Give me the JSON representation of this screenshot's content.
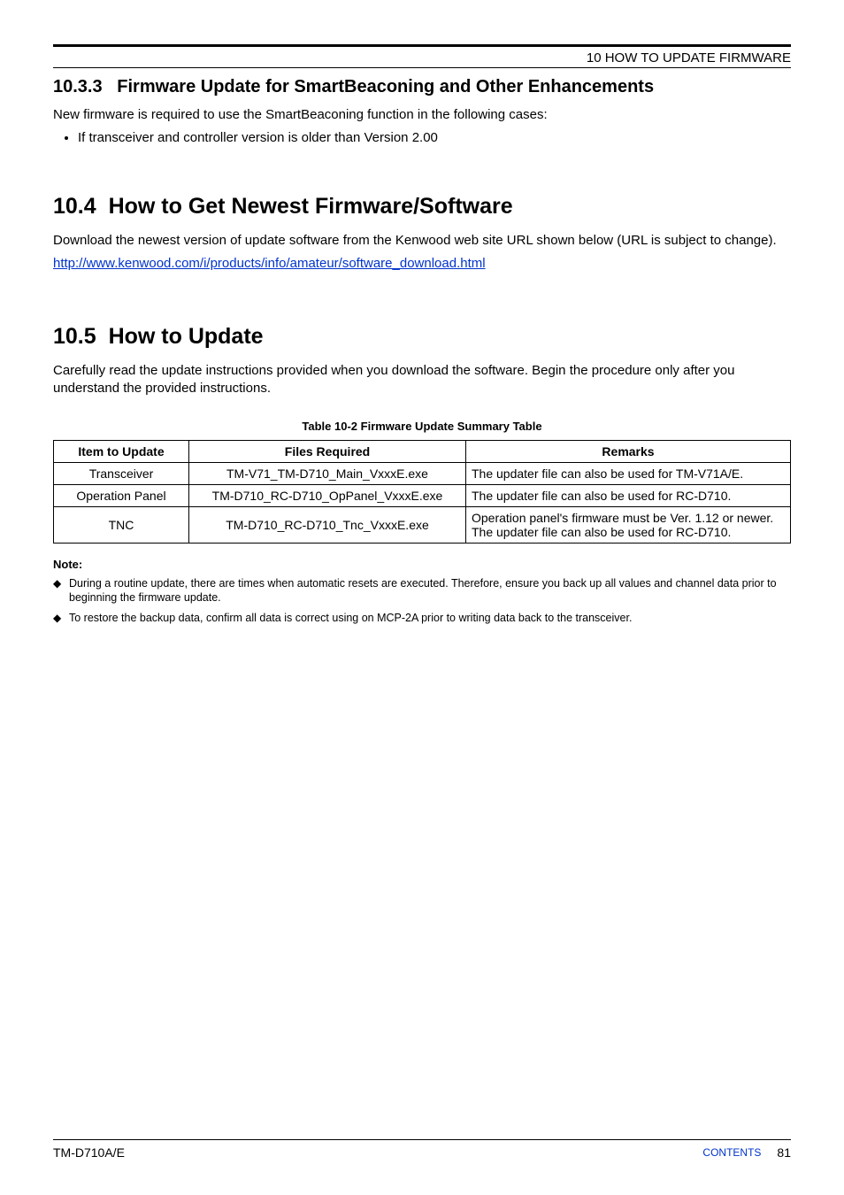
{
  "header": {
    "chapter_line": "10 HOW TO UPDATE FIRMWARE"
  },
  "sec_10_3_3": {
    "number": "10.3.3",
    "title": "Firmware Update for SmartBeaconing and Other Enhancements",
    "intro": "New firmware is required to use the SmartBeaconing function in the following cases:",
    "bullets": [
      "If transceiver and controller version is older than Version 2.00"
    ]
  },
  "sec_10_4": {
    "number": "10.4",
    "title": "How to Get Newest Firmware/Software",
    "paragraph": "Download the newest version of update software from the Kenwood web site URL shown below (URL is subject to change).",
    "link": "http://www.kenwood.com/i/products/info/amateur/software_download.html"
  },
  "sec_10_5": {
    "number": "10.5",
    "title": "How to Update",
    "paragraph": "Carefully read the update instructions provided when you download the software.  Begin the procedure only after you understand the provided instructions."
  },
  "table": {
    "caption": "Table 10-2   Firmware Update Summary Table",
    "headers": {
      "item": "Item to Update",
      "files": "Files Required",
      "remarks": "Remarks"
    },
    "rows": [
      {
        "item": "Transceiver",
        "files": "TM-V71_TM-D710_Main_VxxxE.exe",
        "remarks": "The updater file can also be used for TM-V71A/E."
      },
      {
        "item": "Operation Panel",
        "files": "TM-D710_RC-D710_OpPanel_VxxxE.exe",
        "remarks": "The updater file can also be used for RC-D710."
      },
      {
        "item": "TNC",
        "files": "TM-D710_RC-D710_Tnc_VxxxE.exe",
        "remarks": "Operation panel's firmware must be Ver. 1.12 or newer.\nThe updater file can also be used for RC-D710."
      }
    ]
  },
  "notes": {
    "header": "Note:",
    "items": [
      "During a routine update, there are times when automatic resets are executed.  Therefore, ensure you back up all values and channel data prior to beginning the firmware update.",
      "To restore the backup data, confirm all data is correct using on MCP-2A prior to writing data back to the transceiver."
    ]
  },
  "footer": {
    "left": "TM-D710A/E",
    "contents_label": "CONTENTS",
    "page": "81"
  }
}
